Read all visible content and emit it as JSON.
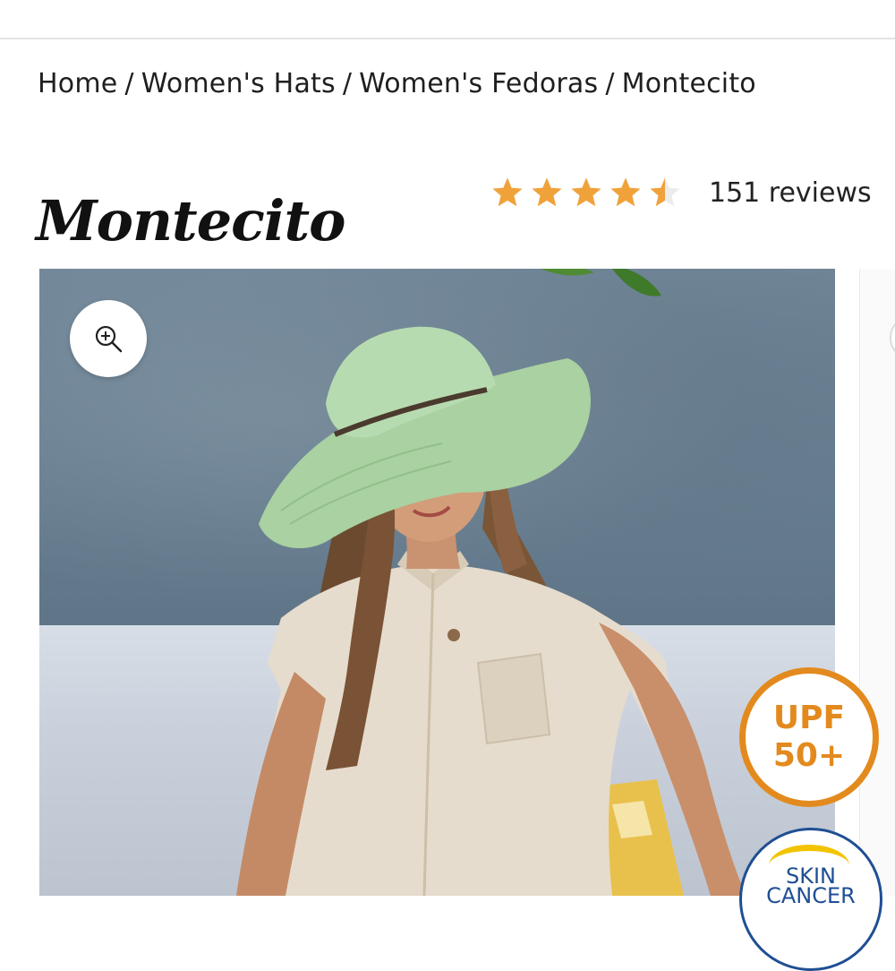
{
  "breadcrumb": {
    "items": [
      "Home",
      "Women's Hats",
      "Women's Fedoras",
      "Montecito"
    ],
    "separator": "/"
  },
  "product": {
    "title": "Montecito",
    "rating": 4.5,
    "rating_max": 5,
    "reviews_label": "151 reviews"
  },
  "gallery": {
    "image_description": "Woman wearing a light green straw fedora with a dark band",
    "zoom_icon": "zoom-in-icon",
    "badges": {
      "upf_line1": "UPF",
      "upf_line2": "50+",
      "skin_cancer_text": "SKIN CANCER"
    }
  },
  "colors": {
    "star": "#f0a23a",
    "upf_orange": "#e38a1f",
    "skin_blue": "#1f4f93",
    "skin_yellow": "#f2c300",
    "hat_green": "#a9d1a1"
  }
}
